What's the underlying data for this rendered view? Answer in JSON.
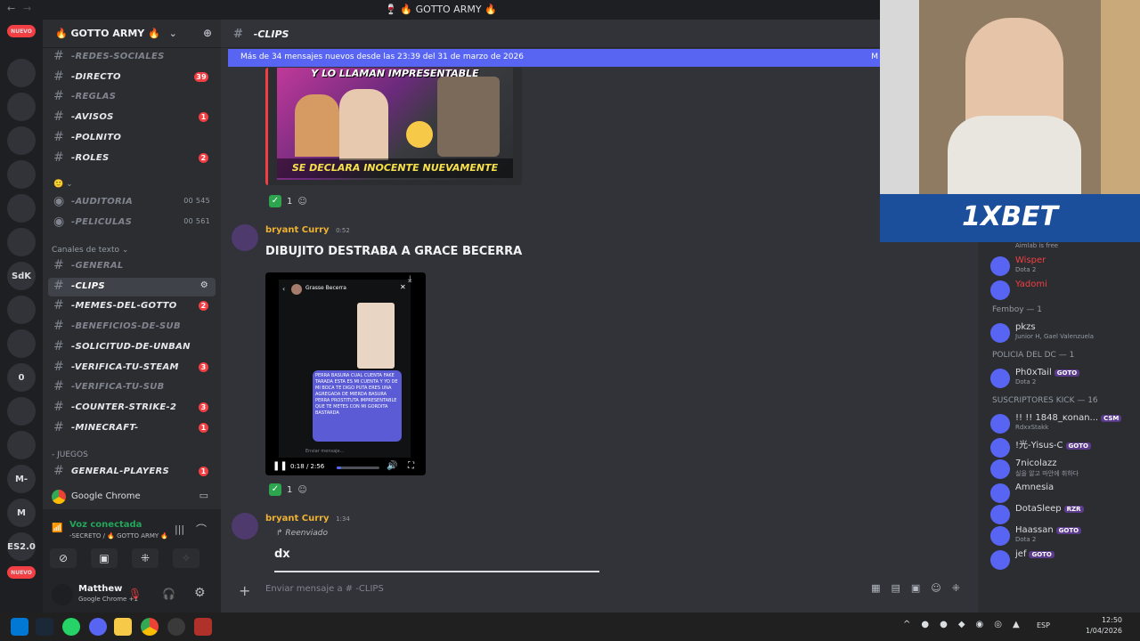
{
  "window": {
    "title": "🍷 🔥 GOTTO ARMY 🔥"
  },
  "servers": [
    {
      "label": "NUEVO",
      "badge": ""
    },
    {
      "label": "",
      "badge": "21"
    },
    {
      "label": "",
      "badge": ""
    },
    {
      "label": "",
      "badge": ""
    },
    {
      "label": "",
      "badge": "326"
    },
    {
      "label": "",
      "badge": "1"
    },
    {
      "label": "",
      "badge": "242"
    },
    {
      "label": "SdK",
      "badge": ""
    },
    {
      "label": "",
      "badge": "1"
    },
    {
      "label": "",
      "badge": "1"
    },
    {
      "label": "0",
      "badge": ""
    },
    {
      "label": "",
      "badge": ""
    },
    {
      "label": "",
      "badge": "67"
    },
    {
      "label": "M-",
      "badge": ""
    },
    {
      "label": "M",
      "badge": ""
    },
    {
      "label": "ES2.0",
      "badge": ""
    },
    {
      "label": "NUEVO",
      "badge": ""
    }
  ],
  "server": {
    "name": "🔥 GOTTO ARMY 🔥"
  },
  "channels": [
    {
      "name": "-REDES-SOCIALES",
      "count": "",
      "muted": true
    },
    {
      "name": "-DIRECTO",
      "count": "39",
      "muted": false
    },
    {
      "name": "-REGLAS",
      "count": "",
      "muted": true
    },
    {
      "name": "-AVISOS",
      "count": "1",
      "muted": false
    },
    {
      "name": "-POLNITO",
      "count": "",
      "muted": false
    },
    {
      "name": "-ROLES",
      "count": "2",
      "muted": false
    }
  ],
  "voice_channels": [
    {
      "name": "-AUDITORIA",
      "counts": "00 545"
    },
    {
      "name": "-PELICULAS",
      "counts": "00 561"
    }
  ],
  "text_category": "Canales de texto",
  "text_channels": [
    {
      "name": "-GENERAL",
      "count": "",
      "muted": true
    },
    {
      "name": "-CLIPS",
      "count": "",
      "muted": false,
      "selected": true
    },
    {
      "name": "-MEMES-DEL-GOTTO",
      "count": "2",
      "muted": false
    },
    {
      "name": "-BENEFICIOS-DE-SUB",
      "count": "",
      "muted": true
    },
    {
      "name": "-SOLICITUD-DE-UNBAN",
      "count": "",
      "muted": false
    },
    {
      "name": "-VERIFICA-TU-STEAM",
      "count": "3",
      "muted": false
    },
    {
      "name": "-VERIFICA-TU-SUB",
      "count": "",
      "muted": true
    },
    {
      "name": "-COUNTER-STRIKE-2",
      "count": "3",
      "muted": false
    },
    {
      "name": "-MINECRAFT-",
      "count": "1",
      "muted": false
    }
  ],
  "games_category": "- JUEGOS",
  "games_channel": {
    "name": "GENERAL-PLAYERS",
    "count": "1"
  },
  "stream_app": "Google Chrome",
  "voice": {
    "status": "Voz conectada",
    "channel": "-SECRETO / 🔥 GOTTO ARMY 🔥"
  },
  "user": {
    "name": "Matthew",
    "status": "Google Chrome +1"
  },
  "chat": {
    "channel": "-CLIPS",
    "new_banner": "Más de 34 mensajes nuevos desde las 23:39 del 31 de marzo de 2026",
    "banner_end": "M",
    "thumb_top": "Y LO LLAMAN IMPRESENTABLE",
    "thumb_bottom": "SE DECLARA INOCENTE NUEVAMENTE",
    "react_count": "1",
    "msg1": {
      "author": "bryant Curry",
      "time": "0:52",
      "text": "DIBUJITO DESTRABA A GRACE BECERRA"
    },
    "video": {
      "profile": "Grasse Becerra",
      "bubble": "PERRA BASURA CUAL CUENTA FAKE TARADA ESTA ES MI CUENTA Y YO DE MI BOCA TE DIGO PUTA ERES UNA AGREGADA DE MIERDA BASURA PERRA PROSTITUTA IMPRESENTABLE QUE TE METES CON MI GORDITA BASTARDA",
      "compose": "Enviar mensaje...",
      "time": "0:18 / 2:56"
    },
    "react2_count": "1",
    "msg2": {
      "author": "bryant Curry",
      "time": "1:34",
      "forwarded": "Reenviado",
      "text": "dx"
    },
    "input_placeholder": "Enviar mensaje a # -CLIPS"
  },
  "stream_overlay": {
    "brand": "1XBET"
  },
  "members": {
    "top_note": "Aimlab is free",
    "items": [
      {
        "name": "Wisper",
        "sub": "Dota 2",
        "color": "#f23f43"
      },
      {
        "name": "Yadomi",
        "sub": "",
        "color": "#f23f43"
      }
    ],
    "cat1": "Femboy — 1",
    "femboy": [
      {
        "name": "pkzs",
        "sub": "Junior H, Gael Valenzuela",
        "color": "#dbdee1"
      }
    ],
    "cat2": "POLICIA DEL DC — 1",
    "policia": [
      {
        "name": "Ph0xTail",
        "tag": "GOTO",
        "sub": "Dota 2",
        "color": "#dbdee1"
      }
    ],
    "cat3": "SUSCRIPTORES KICK — 16",
    "subs": [
      {
        "name": "!! !! 1848_ĸonan...",
        "tag": "CSM",
        "sub": "RdxxStakk"
      },
      {
        "name": "!光-Yisus-C",
        "tag": "GOTO",
        "sub": ""
      },
      {
        "name": "7nicolazz",
        "tag": "",
        "sub": "실을 알고 마안에 취하다"
      },
      {
        "name": "Amnesia",
        "tag": "",
        "sub": ""
      },
      {
        "name": "DotaSleep",
        "tag": "RZR",
        "sub": ""
      },
      {
        "name": "Haassan",
        "tag": "GOTO",
        "sub": "Dota 2"
      },
      {
        "name": "jef",
        "tag": "GOTO",
        "sub": ""
      }
    ]
  },
  "taskbar": {
    "lang": "ESP",
    "time": "12:50",
    "date": "1/04/2026"
  }
}
